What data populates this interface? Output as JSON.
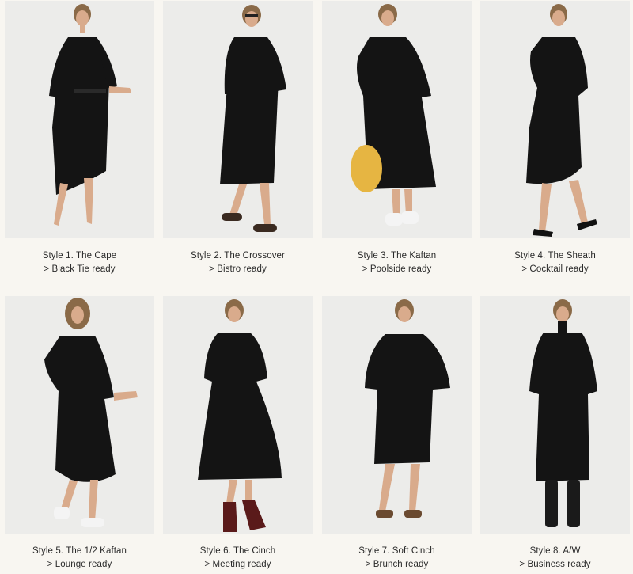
{
  "styles": [
    {
      "title": "Style 1. The Cape",
      "subtitle": "> Black Tie ready"
    },
    {
      "title": "Style 2. The Crossover",
      "subtitle": "> Bistro ready"
    },
    {
      "title": "Style 3. The Kaftan",
      "subtitle": "> Poolside ready"
    },
    {
      "title": "Style 4. The Sheath",
      "subtitle": "> Cocktail ready"
    },
    {
      "title": "Style 5. The 1/2 Kaftan",
      "subtitle": "> Lounge ready"
    },
    {
      "title": "Style 6. The Cinch",
      "subtitle": "> Meeting ready"
    },
    {
      "title": "Style 7. Soft Cinch",
      "subtitle": "> Brunch ready"
    },
    {
      "title": "Style 8. A/W",
      "subtitle": "> Business ready"
    }
  ],
  "colors": {
    "page_background": "#f8f6f1",
    "photo_background": "#ececea",
    "dress": "#141414",
    "skin": "#d9ab8c",
    "hair": "#8a6a48",
    "text": "#2a2a2a"
  },
  "images": [
    "model-black-cape-dress-photo",
    "model-black-crossover-dress-photo",
    "model-black-kaftan-dress-photo",
    "model-black-sheath-dress-photo",
    "model-black-half-kaftan-dress-photo",
    "model-black-cinch-dress-photo",
    "model-black-soft-cinch-dress-photo",
    "model-black-aw-dress-photo"
  ]
}
